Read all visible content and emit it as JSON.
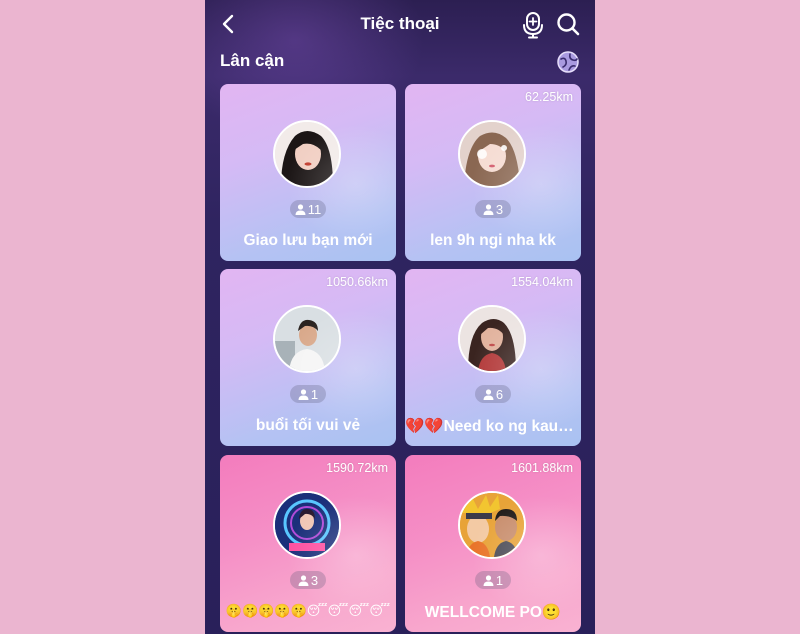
{
  "header": {
    "title": "Tiệc thoại",
    "back_icon": "chevron-left-icon",
    "mic_icon": "microphone-plus-icon",
    "search_icon": "search-icon"
  },
  "section": {
    "title": "Lân cận",
    "globe_icon": "globe-icon"
  },
  "rooms": [
    {
      "distance": "",
      "members": "11",
      "title": "Giao lưu bạn mới",
      "theme": "purple"
    },
    {
      "distance": "62.25km",
      "members": "3",
      "title": "len 9h ngi nha kk",
      "theme": "purple"
    },
    {
      "distance": "1050.66km",
      "members": "1",
      "title": "buổi tối vui vẻ",
      "theme": "purple"
    },
    {
      "distance": "1554.04km",
      "members": "6",
      "title": "💔💔Need ko ng kausa...",
      "theme": "purple"
    },
    {
      "distance": "1590.72km",
      "members": "3",
      "title": "🤫🤫🤫🤫🤫😴😴😴😴",
      "theme": "pink"
    },
    {
      "distance": "1601.88km",
      "members": "1",
      "title": "WELLCOME PO🙂",
      "theme": "pink"
    }
  ],
  "colors": {
    "page_background": "#ebb5d0",
    "app_background": "#2c1f52",
    "card_purple": "#d5baf5",
    "card_pink": "#f58fc6"
  }
}
